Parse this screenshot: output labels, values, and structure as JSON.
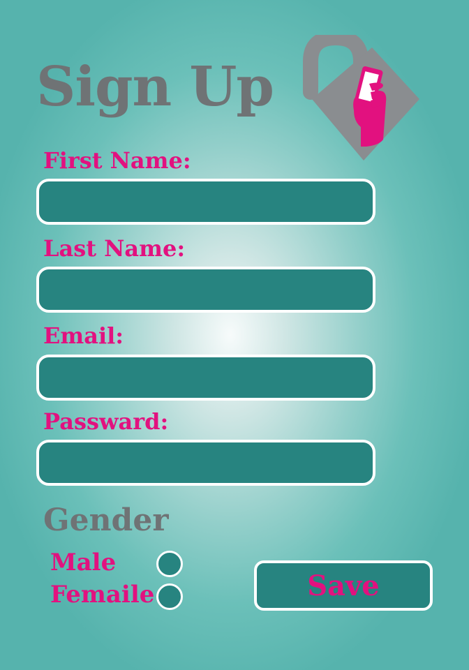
{
  "page": {
    "title": "Sign Up"
  },
  "logo": {
    "icon": "padlock-phone-hand-icon",
    "colors": {
      "lock": "#8a8d90",
      "hand": "#e2117f"
    }
  },
  "form": {
    "fields": [
      {
        "label": "First Name:",
        "value": "",
        "placeholder": ""
      },
      {
        "label": "Last Name:",
        "value": "",
        "placeholder": ""
      },
      {
        "label": "Email:",
        "value": "",
        "placeholder": ""
      },
      {
        "label": "Passward:",
        "value": "",
        "placeholder": ""
      }
    ],
    "gender": {
      "title": "Gender",
      "options": [
        {
          "label": "Male",
          "selected": false
        },
        {
          "label": "Femaile",
          "selected": false
        }
      ]
    },
    "save_label": "Save"
  },
  "colors": {
    "accent": "#e2117f",
    "field_fill": "#278480",
    "field_border": "#ffffff",
    "heading": "#6f7375",
    "background": "#56b3ad"
  }
}
